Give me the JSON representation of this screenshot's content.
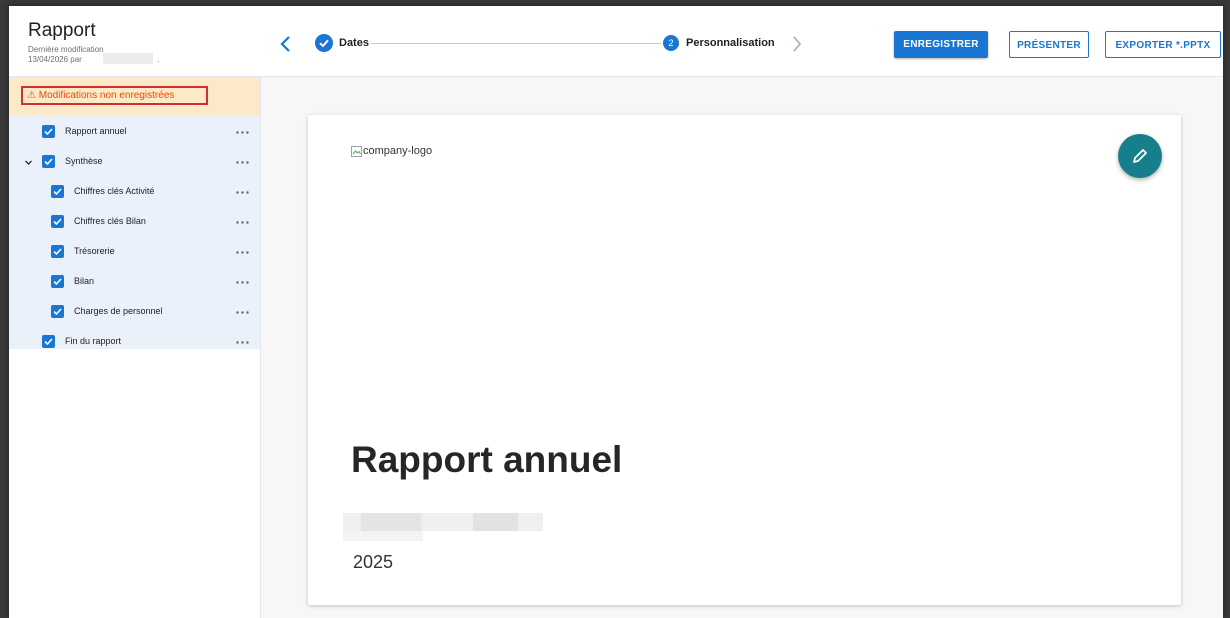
{
  "header": {
    "title": "Rapport",
    "last_modified_label": "Dernière modification",
    "last_modified_value": "13/04/2026 par",
    "trailing_dot": "."
  },
  "stepper": {
    "steps": [
      {
        "label": "Dates",
        "status": "done"
      },
      {
        "number": "2",
        "label": "Personnalisation",
        "status": "current"
      }
    ]
  },
  "actions": {
    "save": "ENREGISTRER",
    "present": "PRÉSENTER",
    "export": "EXPORTER *.PPTX"
  },
  "sidebar": {
    "warning_icon": "⚠",
    "warning_text": "Modifications non enregistrées",
    "items": [
      {
        "label": "Rapport annuel",
        "checked": true
      },
      {
        "label": "Synthèse",
        "checked": true,
        "expanded": true
      },
      {
        "label": "Chiffres clés Activité",
        "checked": true
      },
      {
        "label": "Chiffres clés Bilan",
        "checked": true
      },
      {
        "label": "Trésorerie",
        "checked": true
      },
      {
        "label": "Bilan",
        "checked": true
      },
      {
        "label": "Charges de personnel",
        "checked": true
      },
      {
        "label": "Fin du rapport",
        "checked": true
      }
    ]
  },
  "slide": {
    "logo_alt": "company-logo",
    "title": "Rapport annuel",
    "year": "2025"
  },
  "colors": {
    "primary": "#1976d2",
    "fab": "#177e8c",
    "warning_bg": "#fde8c8",
    "warning_text": "#e65100",
    "warning_border": "#d32f2f",
    "tree_bg": "#eaf1fb"
  },
  "icons": {
    "back": "chevron-left-icon",
    "forward": "chevron-right-icon",
    "step_done": "check-circle-icon",
    "expand": "chevron-down-icon",
    "more": "more-horizontal-icon",
    "edit": "pencil-icon",
    "checkbox": "checkbox-checked-icon",
    "broken_image": "broken-image-icon"
  }
}
